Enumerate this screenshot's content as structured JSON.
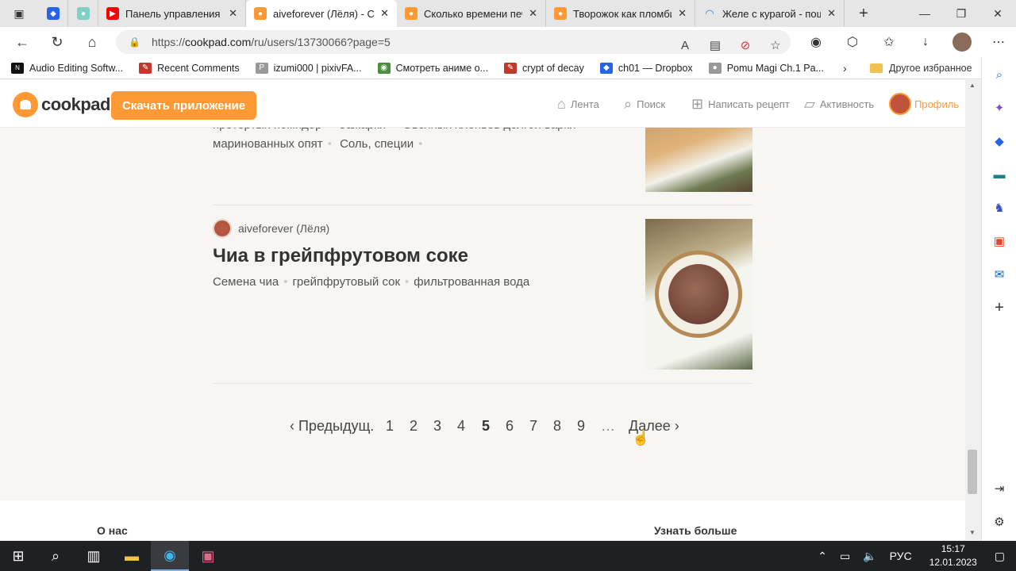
{
  "browser": {
    "tabs": [
      {
        "title": "",
        "icon": "dropbox",
        "color": "#2563ea"
      },
      {
        "title": "",
        "icon": "generic",
        "color": "#7fd1c5"
      },
      {
        "title": "Панель управления ка",
        "icon": "youtube",
        "color": "#ff0000"
      },
      {
        "title": "aiveforever (Лёля) - Со",
        "icon": "cookpad",
        "color": "#ff9933",
        "active": true
      },
      {
        "title": "Сколько времени печ",
        "icon": "cookpad",
        "color": "#ff9933"
      },
      {
        "title": "Творожок как пломби",
        "icon": "cookpad",
        "color": "#ff9933"
      },
      {
        "title": "Желе с курагой - пош",
        "icon": "loading",
        "color": "#2a7fd4"
      }
    ],
    "url_prefix": "https://",
    "url_host": "cookpad.com",
    "url_path": "/ru/users/13730066?page=5",
    "bookmarks": [
      {
        "label": "Audio Editing Softw...",
        "color": "#111"
      },
      {
        "label": "Recent Comments",
        "color": "#c0392b"
      },
      {
        "label": "izumi000 | pixivFA...",
        "color": "#999"
      },
      {
        "label": "Смотреть аниме о...",
        "color": "#4a8f3c"
      },
      {
        "label": "crypt of decay",
        "color": "#c0392b"
      },
      {
        "label": "ch01 — Dropbox",
        "color": "#2563ea"
      },
      {
        "label": "Pomu Magi Ch.1 Pa...",
        "color": "#999"
      }
    ],
    "other_favorites": "Другое избранное"
  },
  "site": {
    "brand": "cookpad",
    "download_button": "Скачать приложение",
    "nav": {
      "feed": "Лента",
      "search": "Поиск",
      "write": "Написать рецепт",
      "activity": "Активность",
      "profile": "Профиль"
    }
  },
  "recipes": {
    "previous": {
      "ingredients_line1": [
        "протертых помидор",
        "Зажарки",
        "Овсяных хлопьев долгой варки"
      ],
      "ingredients_line2": [
        "маринованных опят",
        "Соль, специи"
      ]
    },
    "current": {
      "author": "aiveforever (Лёля)",
      "title": "Чиа в грейпфрутовом соке",
      "ingredients": [
        "Семена чиа",
        "грейпфрутовый сок",
        "фильтрованная вода"
      ]
    }
  },
  "pager": {
    "prev": "‹ Предыдущ.",
    "pages": [
      "1",
      "2",
      "3",
      "4",
      "5",
      "6",
      "7",
      "8",
      "9"
    ],
    "current": "5",
    "ellipsis": "…",
    "next": "Далее ›"
  },
  "footer": {
    "about": "О нас",
    "learn_more": "Узнать больше"
  },
  "taskbar": {
    "lang": "РУС",
    "time": "15:17",
    "date": "12.01.2023"
  }
}
